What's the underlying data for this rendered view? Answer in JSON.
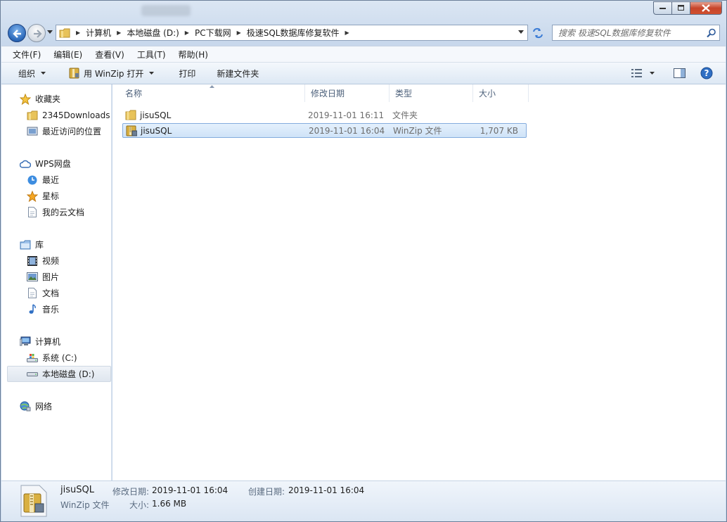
{
  "address": {
    "crumbs": [
      "计算机",
      "本地磁盘 (D:)",
      "PC下载网",
      "极速SQL数据库修复软件"
    ],
    "search_placeholder": "搜索 极速SQL数据库修复软件"
  },
  "menu": [
    "文件(F)",
    "编辑(E)",
    "查看(V)",
    "工具(T)",
    "帮助(H)"
  ],
  "toolbar": {
    "organize": "组织",
    "open_with": "用 WinZip 打开",
    "print": "打印",
    "new_folder": "新建文件夹"
  },
  "sidebar": {
    "favorites": {
      "label": "收藏夹",
      "items": [
        "2345Downloads",
        "最近访问的位置"
      ]
    },
    "wps": {
      "label": "WPS网盘",
      "items": [
        "最近",
        "星标",
        "我的云文档"
      ]
    },
    "libraries": {
      "label": "库",
      "items": [
        "视频",
        "图片",
        "文档",
        "音乐"
      ]
    },
    "computer": {
      "label": "计算机",
      "items": [
        "系统 (C:)",
        "本地磁盘 (D:)"
      ]
    },
    "network": {
      "label": "网络"
    }
  },
  "columns": {
    "name": "名称",
    "date": "修改日期",
    "type": "类型",
    "size": "大小"
  },
  "files": [
    {
      "name": "jisuSQL",
      "date": "2019-11-01 16:11",
      "type": "文件夹",
      "size": "",
      "icon": "folder-icon"
    },
    {
      "name": "jisuSQL",
      "date": "2019-11-01 16:04",
      "type": "WinZip 文件",
      "size": "1,707 KB",
      "icon": "winzip-icon"
    }
  ],
  "details": {
    "name": "jisuSQL",
    "type": "WinZip 文件",
    "modified_label": "修改日期:",
    "modified": "2019-11-01 16:04",
    "created_label": "创建日期:",
    "created": "2019-11-01 16:04",
    "size_label": "大小:",
    "size": "1.66 MB"
  },
  "colors": {
    "accent": "#3a7bd5",
    "selection": "#cfe3f8",
    "close_button": "#c7452b"
  }
}
